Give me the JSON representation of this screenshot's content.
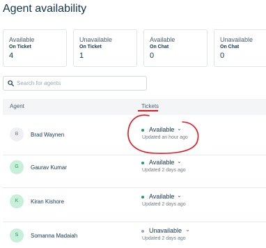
{
  "page": {
    "title": "Agent availability"
  },
  "stats": [
    {
      "label": "Available",
      "sub": "On Ticket",
      "count": "4"
    },
    {
      "label": "Unavailable",
      "sub": "On Ticket",
      "count": "1"
    },
    {
      "label": "Available",
      "sub": "On Chat",
      "count": "0"
    },
    {
      "label": "Unavailable",
      "sub": "On Chat",
      "count": "0"
    }
  ],
  "search": {
    "placeholder": "Search for agents"
  },
  "table": {
    "columns": {
      "agent": "Agent",
      "tickets": "Tickets"
    },
    "rows": [
      {
        "initial": "B",
        "name": "Brad Waynen",
        "status": "Available",
        "updated": "Updated an hour ago"
      },
      {
        "initial": "G",
        "name": "Gaurav Kumar",
        "status": "Available",
        "updated": "Updated 2 days ago"
      },
      {
        "initial": "K",
        "name": "Kiran Kishore",
        "status": "Available",
        "updated": "Updated 2 days ago"
      },
      {
        "initial": "S",
        "name": "Somanna Madaiah",
        "status": "Unavailable",
        "updated": "Updated 2 days ago"
      }
    ]
  },
  "colors": {
    "available_dot": "#1f9d6a",
    "unavailable_dot": "#9aa7b3",
    "avatar_green_bg": "#c8efd9",
    "avatar_green_text": "#1f9d6a",
    "avatar_gray_bg": "#eef0f2",
    "avatar_gray_text": "#6f7c87",
    "annotation_red": "#e8141b",
    "tickets_underline": "#e8141b"
  },
  "icons": {
    "search": "search-icon",
    "dropdown": "chevron-down-icon"
  }
}
